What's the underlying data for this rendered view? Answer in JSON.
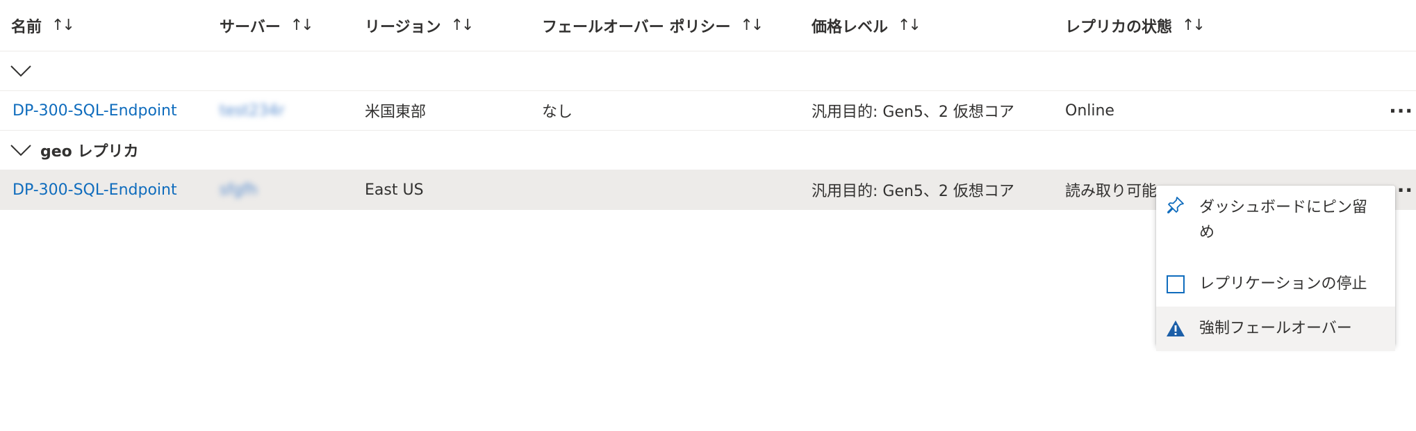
{
  "columns": [
    {
      "label": "名前",
      "sort_icon": "↑↓"
    },
    {
      "label": "サーバー",
      "sort_icon": "↑↓"
    },
    {
      "label": "リージョン",
      "sort_icon": "↑↓"
    },
    {
      "label": "フェールオーバー ポリシー",
      "sort_icon": "↑↓"
    },
    {
      "label": "価格レベル",
      "sort_icon": "↑↓"
    },
    {
      "label": "レプリカの状態",
      "sort_icon": "↑↓"
    }
  ],
  "groups": [
    {
      "label": "",
      "expanded": true,
      "rows": [
        {
          "name": "DP-300-SQL-Endpoint",
          "server": "test234r",
          "region": "米国東部",
          "failover_policy": "なし",
          "pricing_tier": "汎用目的: Gen5、2 仮想コア",
          "replica_state": "Online",
          "more": "···"
        }
      ]
    },
    {
      "label": "geo レプリカ",
      "expanded": true,
      "rows": [
        {
          "name": "DP-300-SQL-Endpoint",
          "server": "sfgfh",
          "region": "East US",
          "failover_policy": "",
          "pricing_tier": "汎用目的: Gen5、2 仮想コア",
          "replica_state": "読み取り可能",
          "more": "···"
        }
      ]
    }
  ],
  "context_menu": {
    "items": [
      {
        "label": "ダッシュボードにピン留め",
        "label_line1": "ダッシュボードにピン留",
        "label_line2": "め",
        "icon": "pin-icon"
      },
      {
        "label": "レプリケーションの停止",
        "icon": "stop-square-icon"
      },
      {
        "label": "強制フェールオーバー",
        "icon": "warning-icon"
      }
    ]
  },
  "colors": {
    "link": "#0f6cbd",
    "selected_row": "#edebe9",
    "icon_blue": "#0f6cbd",
    "warning_icon": "#1c5fa8"
  }
}
